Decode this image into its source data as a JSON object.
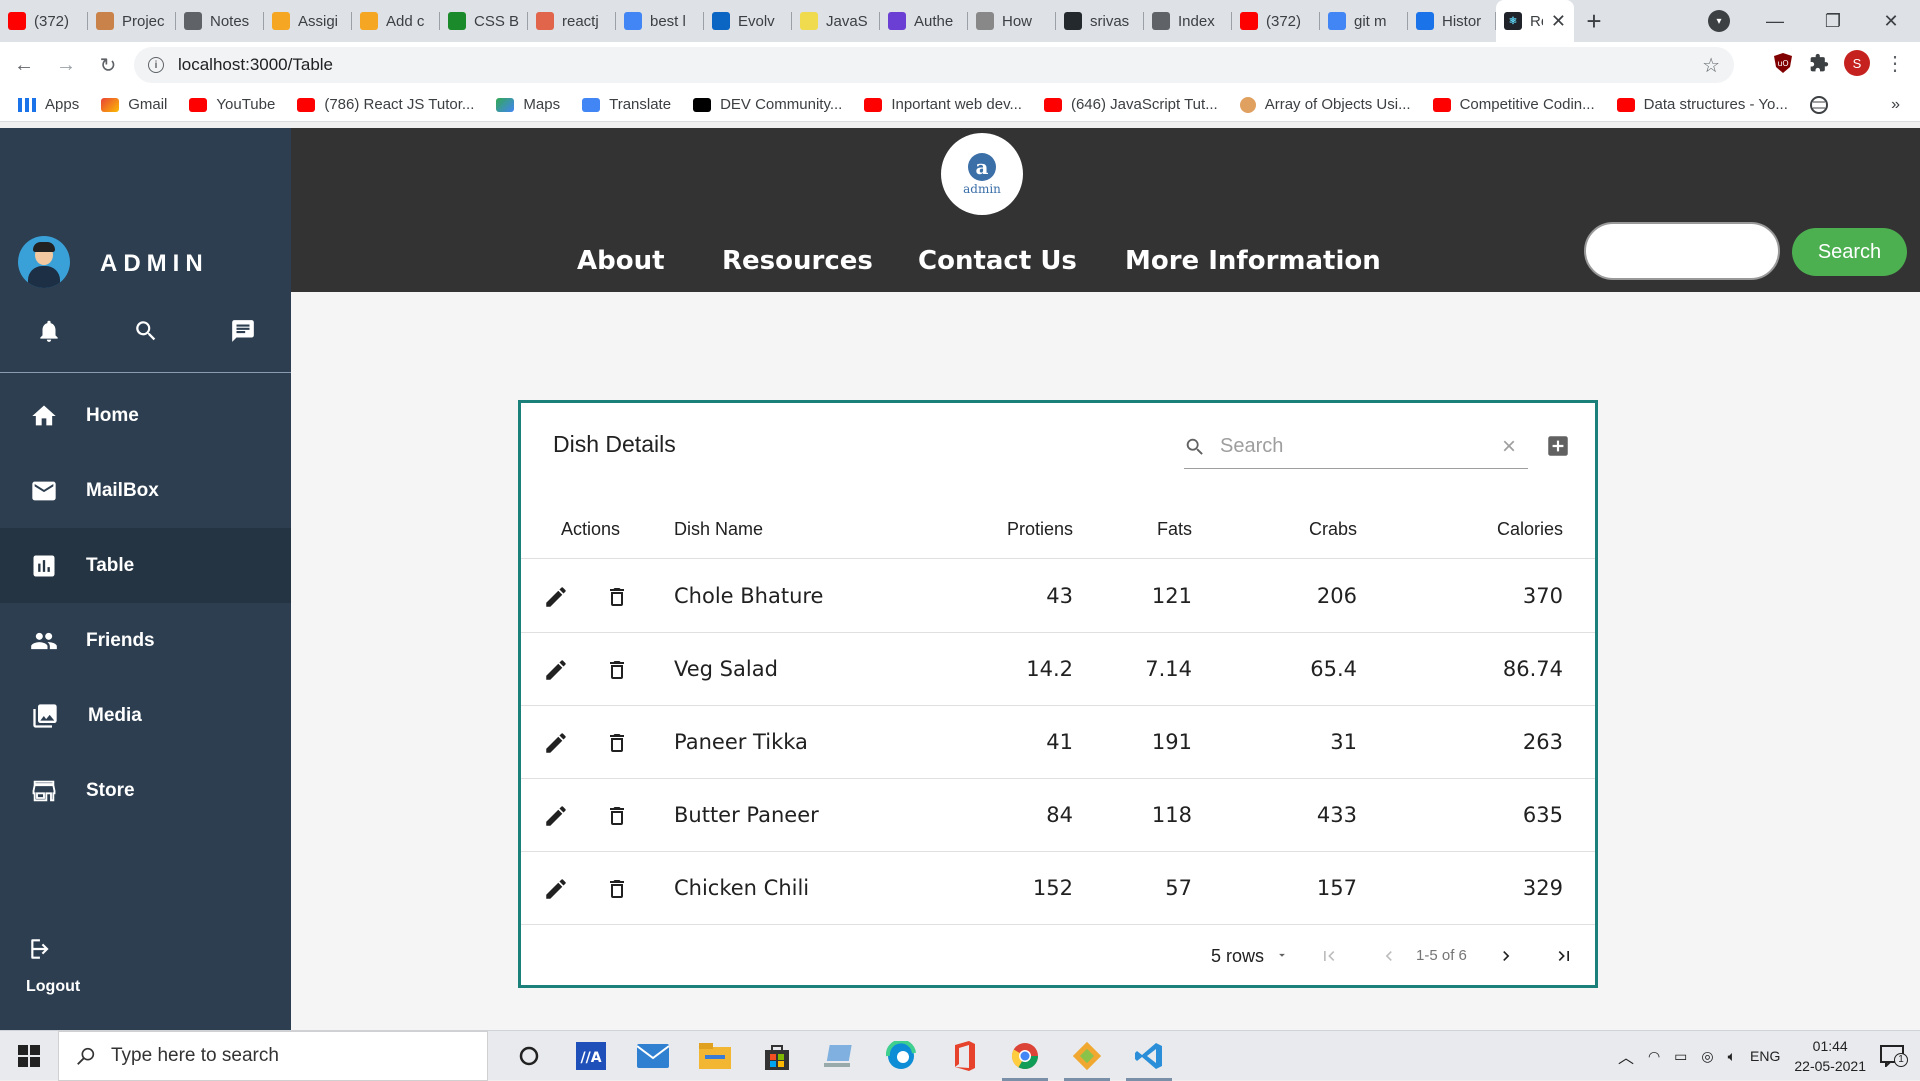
{
  "browser": {
    "tabs": [
      {
        "title": "(372)",
        "icon": "youtube-icon",
        "color": "#ff0000"
      },
      {
        "title": "Projec",
        "icon": "person-icon",
        "color": "#c9834a"
      },
      {
        "title": "Notes",
        "icon": "globe-icon",
        "color": "#5f6368"
      },
      {
        "title": "Assigi",
        "icon": "firebase-icon",
        "color": "#f5a623"
      },
      {
        "title": "Add c",
        "icon": "firebase-icon",
        "color": "#f5a623"
      },
      {
        "title": "CSS B",
        "icon": "w-icon",
        "color": "#1b8a2a"
      },
      {
        "title": "reactj",
        "icon": "feather-icon",
        "color": "#e0654b"
      },
      {
        "title": "best l",
        "icon": "google-icon",
        "color": "#4285f4"
      },
      {
        "title": "Evolv",
        "icon": "linkedin-icon",
        "color": "#0a66c2"
      },
      {
        "title": "JavaS",
        "icon": "js-icon",
        "color": "#f0db4f"
      },
      {
        "title": "Authe",
        "icon": "auth0-icon",
        "color": "#6b3fd4"
      },
      {
        "title": "How",
        "icon": "medium-icon",
        "color": "#888888"
      },
      {
        "title": "srivas",
        "icon": "github-icon",
        "color": "#24292e"
      },
      {
        "title": "Index",
        "icon": "globe-icon",
        "color": "#5f6368"
      },
      {
        "title": "(372)",
        "icon": "youtube-icon",
        "color": "#ff0000"
      },
      {
        "title": "git m",
        "icon": "google-icon",
        "color": "#4285f4"
      },
      {
        "title": "Histor",
        "icon": "history-icon",
        "color": "#1a73e8"
      }
    ],
    "active_tab": {
      "title": "Re",
      "icon": "react-icon",
      "color": "#20232a"
    },
    "url": "localhost:3000/Table",
    "profile_initial": "S",
    "bookmarks": [
      {
        "label": "Apps",
        "kind": "grid"
      },
      {
        "label": "Gmail",
        "kind": "gm"
      },
      {
        "label": "YouTube",
        "kind": "yt"
      },
      {
        "label": "(786) React JS Tutor...",
        "kind": "yt"
      },
      {
        "label": "Maps",
        "kind": "mp"
      },
      {
        "label": "Translate",
        "kind": "tr"
      },
      {
        "label": "DEV Community...",
        "kind": "dev"
      },
      {
        "label": "Inportant web dev...",
        "kind": "yt"
      },
      {
        "label": "(646) JavaScript Tut...",
        "kind": "yt"
      },
      {
        "label": "Array of Objects Usi...",
        "kind": "av"
      },
      {
        "label": "Competitive Codin...",
        "kind": "yt"
      },
      {
        "label": "Data structures - Yo...",
        "kind": "yt"
      }
    ],
    "bookmarks_more": "»"
  },
  "sidebar": {
    "title": "ADMIN",
    "items": [
      {
        "label": "Home",
        "icon": "home-icon"
      },
      {
        "label": "MailBox",
        "icon": "mail-icon"
      },
      {
        "label": "Table",
        "icon": "chart-icon",
        "active": true
      },
      {
        "label": "Friends",
        "icon": "people-icon"
      },
      {
        "label": "Media",
        "icon": "photo-library-icon"
      },
      {
        "label": "Store",
        "icon": "store-icon"
      }
    ],
    "logout_label": "Logout"
  },
  "topbar": {
    "logo_letter": "a",
    "logo_text": "admin",
    "menu": [
      "About",
      "Resources",
      "Contact Us",
      "More Information"
    ],
    "search_label": "Search"
  },
  "table": {
    "title": "Dish Details",
    "search_placeholder": "Search",
    "columns": [
      "Actions",
      "Dish Name",
      "Protiens",
      "Fats",
      "Crabs",
      "Calories"
    ],
    "rows": [
      [
        "Chole Bhature",
        "43",
        "121",
        "206",
        "370"
      ],
      [
        "Veg Salad",
        "14.2",
        "7.14",
        "65.4",
        "86.74"
      ],
      [
        "Paneer Tikka",
        "41",
        "191",
        "31",
        "263"
      ],
      [
        "Butter Paneer",
        "84",
        "118",
        "433",
        "635"
      ],
      [
        "Chicken Chili",
        "152",
        "57",
        "157",
        "329"
      ]
    ],
    "rows_per_page": "5 rows",
    "page_info": "1-5 of 6"
  },
  "taskbar": {
    "search_placeholder": "Type here to search",
    "lang": "ENG",
    "time": "01:44",
    "date": "22-05-2021",
    "notification_count": "1"
  }
}
